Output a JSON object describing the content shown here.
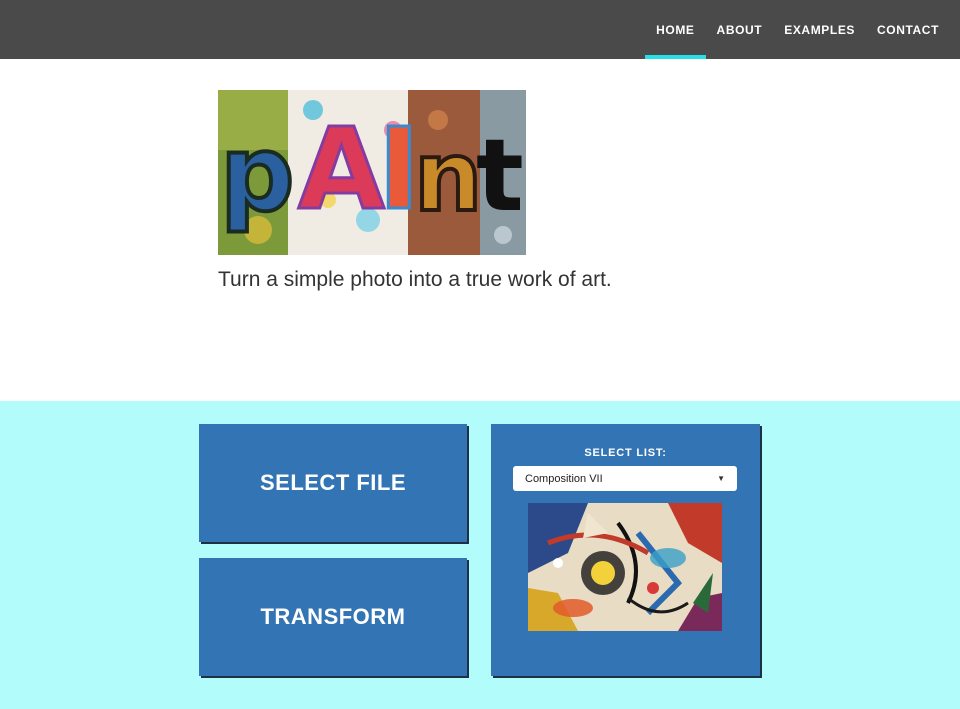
{
  "nav": {
    "items": [
      "HOME",
      "ABOUT",
      "EXAMPLES",
      "CONTACT"
    ],
    "active": "HOME",
    "accent_color": "#25e0e6"
  },
  "hero": {
    "logo_text": "pAInt",
    "tagline": "Turn a simple photo into a true work of art."
  },
  "actions": {
    "select_file_label": "SELECT FILE",
    "transform_label": "TRANSFORM"
  },
  "style_picker": {
    "label": "SELECT LIST:",
    "selected": "Composition VII",
    "chevron_icon": "triangle-down-icon"
  },
  "colors": {
    "topbar": "#4a4a4a",
    "panel_bg": "#b3fcfc",
    "button_blue": "#3375b4"
  }
}
